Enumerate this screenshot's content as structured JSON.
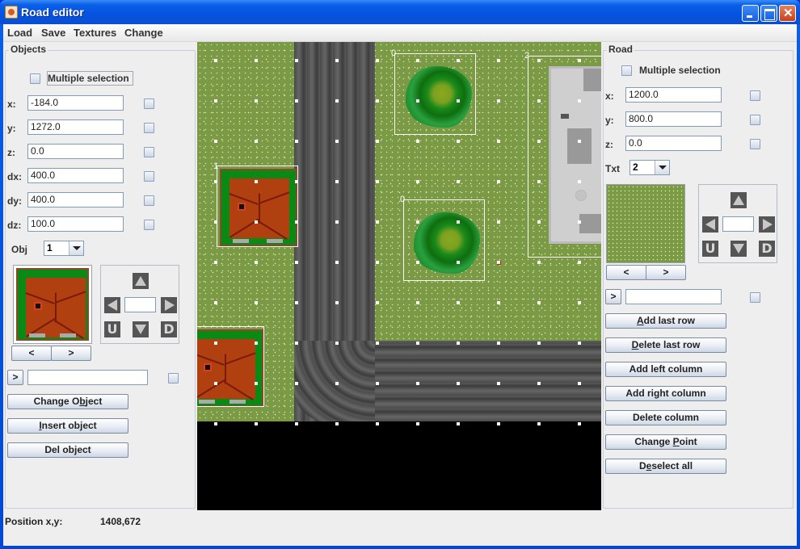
{
  "window": {
    "title": "Road editor",
    "icon": "java-cup-icon"
  },
  "menu": [
    "Load",
    "Save",
    "Textures",
    "Change"
  ],
  "objects_panel": {
    "title": "Objects",
    "multiple_selection_label": "Multiple selection",
    "multiple_selection_checked": false,
    "fields": [
      {
        "label": "x:",
        "value": "-184.0"
      },
      {
        "label": "y:",
        "value": "1272.0"
      },
      {
        "label": "z:",
        "value": "0.0"
      },
      {
        "label": "dx:",
        "value": "400.0"
      },
      {
        "label": "dy:",
        "value": "400.0"
      },
      {
        "label": "dz:",
        "value": "100.0"
      }
    ],
    "obj_label": "Obj",
    "obj_selected": "1",
    "preview_prev": "<",
    "preview_next": ">",
    "go_button": ">",
    "go_input": "",
    "pad_letters": {
      "up": "U",
      "down": "D"
    },
    "pad_value": "",
    "buttons": [
      {
        "label_pre": "Change O",
        "mnemonic": "b",
        "label_post": "ject"
      },
      {
        "label_pre": "",
        "mnemonic": "I",
        "label_post": "nsert object"
      },
      {
        "label_pre": "Del object",
        "mnemonic": "",
        "label_post": ""
      }
    ]
  },
  "road_panel": {
    "title": "Road",
    "multiple_selection_label": "Multiple selection",
    "multiple_selection_checked": false,
    "fields": [
      {
        "label": "x:",
        "value": "1200.0"
      },
      {
        "label": "y:",
        "value": "800.0"
      },
      {
        "label": "z:",
        "value": "0.0"
      }
    ],
    "txt_label": "Txt",
    "txt_selected": "2",
    "preview_prev": "<",
    "preview_next": ">",
    "go_button": ">",
    "go_input": "",
    "pad_letters": {
      "up": "U",
      "down": "D"
    },
    "pad_value": "",
    "buttons": [
      {
        "label_pre": "",
        "mnemonic": "A",
        "label_post": "dd last row"
      },
      {
        "label_pre": "",
        "mnemonic": "D",
        "label_post": "elete last row"
      },
      {
        "label_pre": "Add left column",
        "mnemonic": "",
        "label_post": ""
      },
      {
        "label_pre": "Add right column",
        "mnemonic": "",
        "label_post": ""
      },
      {
        "label_pre": "Delete column",
        "mnemonic": "",
        "label_post": ""
      },
      {
        "label_pre": "Change ",
        "mnemonic": "P",
        "label_post": "oint"
      },
      {
        "label_pre": "D",
        "mnemonic": "e",
        "label_post": "select all"
      }
    ]
  },
  "canvas": {
    "object_labels": [
      "1",
      "1",
      "0",
      "0",
      "2"
    ],
    "colors": {
      "grass": "#7b9a45",
      "road": "#555555",
      "house_roof": "#b04010",
      "selection": "#ffffff",
      "marker": "#e01010"
    }
  },
  "status": {
    "label": "Position x,y:",
    "value": "1408,672"
  }
}
